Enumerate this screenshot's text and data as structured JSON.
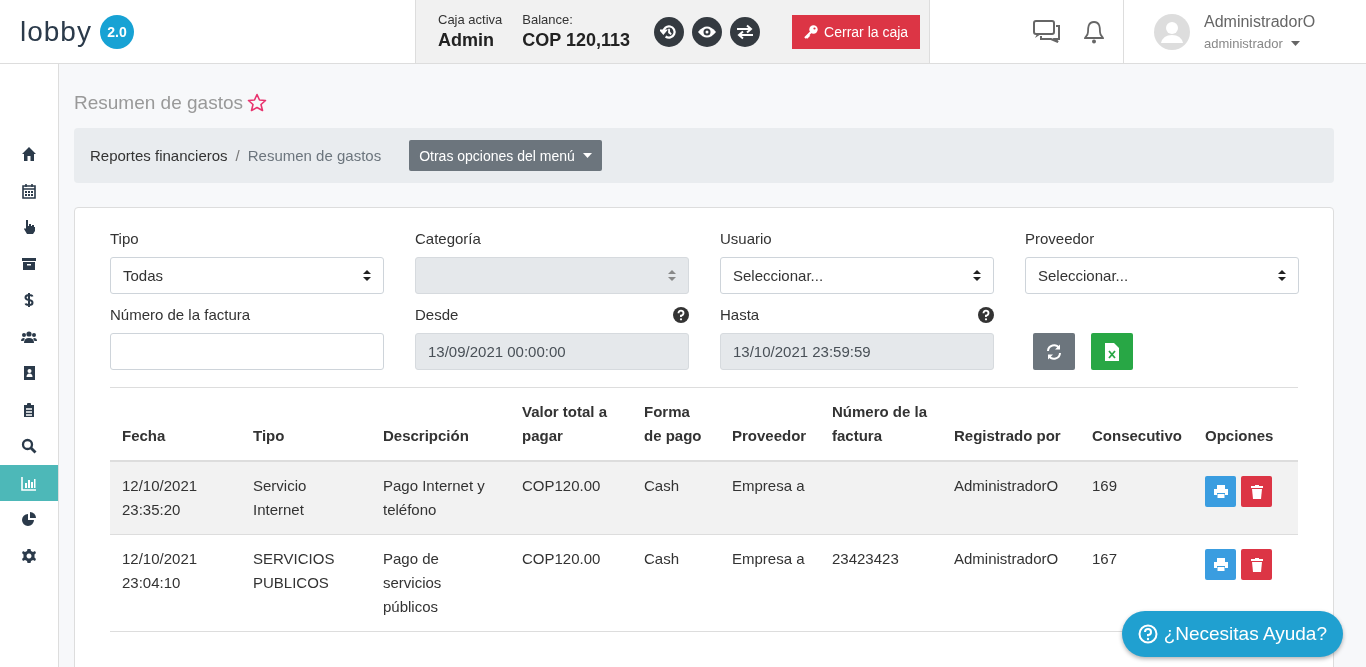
{
  "header": {
    "logo": "lobby",
    "version": "2.0",
    "cash_label": "Caja activa",
    "cash_value": "Admin",
    "balance_label": "Balance:",
    "balance_value": "COP 120,113",
    "close_button": "Cerrar la caja",
    "user_name": "AdministradorO",
    "user_role": "administrador"
  },
  "sidebar": {
    "items": [
      {
        "selected": false
      },
      {
        "selected": false
      },
      {
        "selected": false
      },
      {
        "selected": false
      },
      {
        "selected": false
      },
      {
        "selected": false
      },
      {
        "selected": false
      },
      {
        "selected": false
      },
      {
        "selected": false
      },
      {
        "selected": true
      },
      {
        "selected": false
      },
      {
        "selected": false
      }
    ]
  },
  "page_title": "Resumen de gastos",
  "breadcrumb": {
    "items": [
      "Reportes financieros",
      "Resumen de gastos"
    ],
    "separator": "/",
    "menu_button": "Otras opciones del menú"
  },
  "filters": [
    {
      "label": "Tipo",
      "kind": "select",
      "value": "Todas",
      "disabled": false,
      "help": false
    },
    {
      "label": "Categoría",
      "kind": "select",
      "disabled": true,
      "help": false
    },
    {
      "label": "Usuario",
      "kind": "select",
      "value": "Seleccionar...",
      "disabled": false,
      "help": false
    },
    {
      "label": "Proveedor",
      "kind": "select",
      "value": "Seleccionar...",
      "disabled": false,
      "help": false
    },
    {
      "label": "Número de la factura",
      "kind": "input",
      "disabled": false,
      "help": false
    },
    {
      "label": "Desde",
      "kind": "input",
      "value": "13/09/2021 00:00:00",
      "disabled": true,
      "help": true
    },
    {
      "label": "Hasta",
      "kind": "input",
      "value": "13/10/2021 23:59:59",
      "disabled": true,
      "help": true
    }
  ],
  "table": {
    "columns": [
      "Fecha",
      "Tipo",
      "Descripción",
      "Valor total a pagar",
      "Forma de pago",
      "Proveedor",
      "Número de la factura",
      "Registrado por",
      "Consecutivo",
      "Opciones"
    ],
    "rows": [
      {
        "cells": [
          "12/10/2021 23:35:20",
          "Servicio Internet",
          "Pago Internet y teléfono",
          "COP120.00",
          "Cash",
          "Empresa a",
          "",
          "AdministradorO",
          "169"
        ]
      },
      {
        "cells": [
          "12/10/2021 23:04:10",
          "SERVICIOS PUBLICOS",
          "Pago de servicios públicos",
          "COP120.00",
          "Cash",
          "Empresa a",
          "23423423",
          "AdministradorO",
          "167"
        ]
      }
    ]
  },
  "help_button": "¿Necesitas Ayuda?"
}
